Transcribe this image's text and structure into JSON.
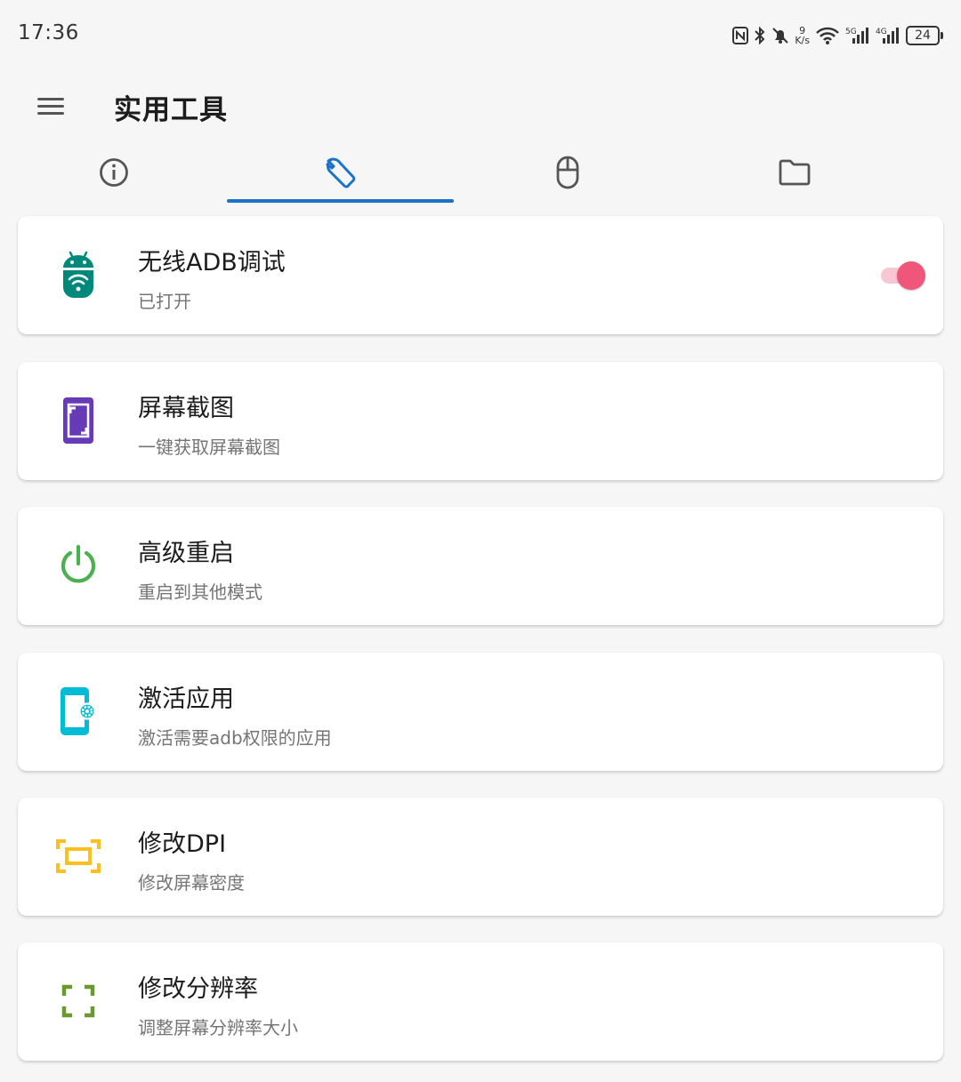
{
  "status_bar": {
    "time": "17:36",
    "net_speed_value": "9",
    "net_speed_unit": "K/s",
    "battery": "24",
    "icons": [
      "nfc-icon",
      "bluetooth-icon",
      "mute-icon",
      "wifi-icon",
      "signal-5g-icon",
      "signal-4g-icon",
      "battery-icon"
    ]
  },
  "app_bar": {
    "title": "实用工具"
  },
  "tabs": [
    {
      "icon": "info-icon",
      "selected": false
    },
    {
      "icon": "wrench-icon",
      "selected": true
    },
    {
      "icon": "mouse-icon",
      "selected": false
    },
    {
      "icon": "folder-icon",
      "selected": false
    }
  ],
  "colors": {
    "accent": "#1a73c9",
    "toggle_on": "#f0557a",
    "adb_icon": "#00897b",
    "screenshot_icon": "#673ab7",
    "power_icon": "#4caf50",
    "activate_icon": "#00bcd4",
    "dpi_icon": "#f9c01e",
    "resolution_icon": "#6a9a2e"
  },
  "tools": [
    {
      "title": "无线ADB调试",
      "subtitle": "已打开",
      "icon": "android-wifi-icon",
      "toggle": true
    },
    {
      "title": "屏幕截图",
      "subtitle": "一键获取屏幕截图",
      "icon": "screenshot-icon"
    },
    {
      "title": "高级重启",
      "subtitle": "重启到其他模式",
      "icon": "power-icon"
    },
    {
      "title": "激活应用",
      "subtitle": "激活需要adb权限的应用",
      "icon": "phone-settings-icon"
    },
    {
      "title": "修改DPI",
      "subtitle": "修改屏幕密度",
      "icon": "dpi-frame-icon"
    },
    {
      "title": "修改分辨率",
      "subtitle": "调整屏幕分辨率大小",
      "icon": "fullscreen-icon"
    }
  ]
}
